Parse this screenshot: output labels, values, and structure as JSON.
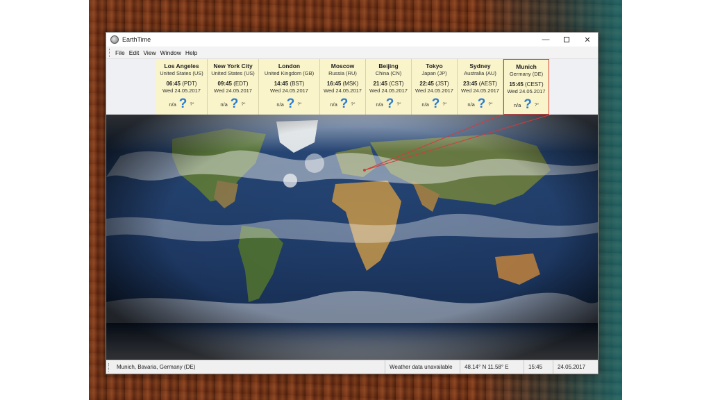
{
  "window": {
    "title": "EarthTime"
  },
  "window_controls": {
    "minimize": "—",
    "close": "✕"
  },
  "menu": [
    "File",
    "Edit",
    "View",
    "Window",
    "Help"
  ],
  "cities": [
    {
      "name": "Los Angeles",
      "country": "United States (US)",
      "time": "06:45",
      "tz": "(PDT)",
      "date": "Wed 24.05.2017",
      "weather": "n/a",
      "weather_icon": "question-mark-icon",
      "temp": "?°"
    },
    {
      "name": "New York City",
      "country": "United States (US)",
      "time": "09:45",
      "tz": "(EDT)",
      "date": "Wed 24.05.2017",
      "weather": "n/a",
      "weather_icon": "question-mark-icon",
      "temp": "?°"
    },
    {
      "name": "London",
      "country": "United Kingdom (GB)",
      "time": "14:45",
      "tz": "(BST)",
      "date": "Wed 24.05.2017",
      "weather": "n/a",
      "weather_icon": "question-mark-icon",
      "temp": "?°"
    },
    {
      "name": "Moscow",
      "country": "Russia (RU)",
      "time": "16:45",
      "tz": "(MSK)",
      "date": "Wed 24.05.2017",
      "weather": "n/a",
      "weather_icon": "question-mark-icon",
      "temp": "?°"
    },
    {
      "name": "Beijing",
      "country": "China (CN)",
      "time": "21:45",
      "tz": "(CST)",
      "date": "Wed 24.05.2017",
      "weather": "n/a",
      "weather_icon": "question-mark-icon",
      "temp": "?°"
    },
    {
      "name": "Tokyo",
      "country": "Japan (JP)",
      "time": "22:45",
      "tz": "(JST)",
      "date": "Wed 24.05.2017",
      "weather": "n/a",
      "weather_icon": "question-mark-icon",
      "temp": "?°"
    },
    {
      "name": "Sydney",
      "country": "Australia (AU)",
      "time": "23:45",
      "tz": "(AEST)",
      "date": "Wed 24.05.2017",
      "weather": "n/a",
      "weather_icon": "question-mark-icon",
      "temp": "?°"
    },
    {
      "name": "Munich",
      "country": "Germany (DE)",
      "time": "15:45",
      "tz": "(CEST)",
      "date": "Wed 24.05.2017",
      "weather": "n/a",
      "weather_icon": "question-mark-icon",
      "temp": "?°",
      "selected": true
    }
  ],
  "status": {
    "location": "Munich, Bavaria, Germany (DE)",
    "weather": "Weather data unavailable",
    "coords": "48.14° N  11.58° E",
    "time": "15:45",
    "date": "24.05.2017"
  },
  "colors": {
    "card_bg": "#f9f4c9",
    "selection": "#d23b3b",
    "weather_icon": "#2a7bd0",
    "ocean": "#1e3a66"
  }
}
